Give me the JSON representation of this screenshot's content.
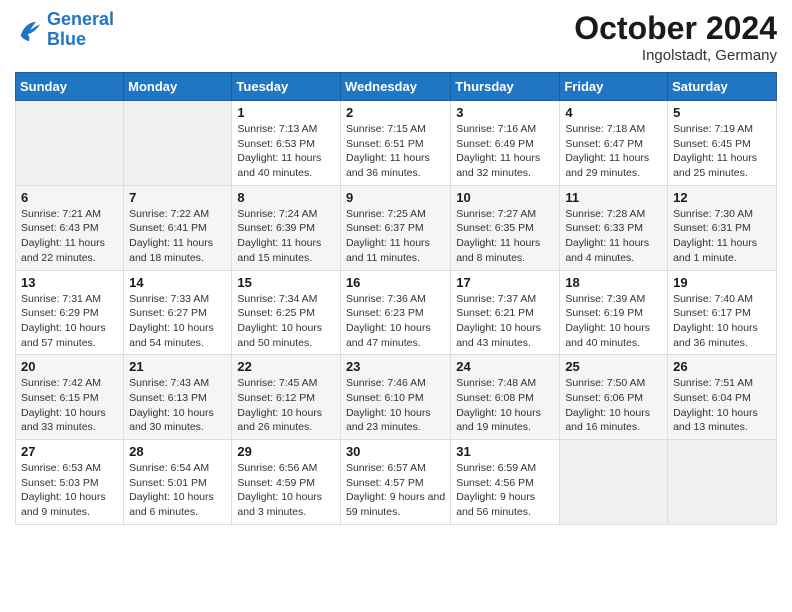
{
  "logo": {
    "line1": "General",
    "line2": "Blue"
  },
  "title": "October 2024",
  "location": "Ingolstadt, Germany",
  "weekdays": [
    "Sunday",
    "Monday",
    "Tuesday",
    "Wednesday",
    "Thursday",
    "Friday",
    "Saturday"
  ],
  "weeks": [
    [
      {
        "day": "",
        "info": ""
      },
      {
        "day": "",
        "info": ""
      },
      {
        "day": "1",
        "info": "Sunrise: 7:13 AM\nSunset: 6:53 PM\nDaylight: 11 hours and 40 minutes."
      },
      {
        "day": "2",
        "info": "Sunrise: 7:15 AM\nSunset: 6:51 PM\nDaylight: 11 hours and 36 minutes."
      },
      {
        "day": "3",
        "info": "Sunrise: 7:16 AM\nSunset: 6:49 PM\nDaylight: 11 hours and 32 minutes."
      },
      {
        "day": "4",
        "info": "Sunrise: 7:18 AM\nSunset: 6:47 PM\nDaylight: 11 hours and 29 minutes."
      },
      {
        "day": "5",
        "info": "Sunrise: 7:19 AM\nSunset: 6:45 PM\nDaylight: 11 hours and 25 minutes."
      }
    ],
    [
      {
        "day": "6",
        "info": "Sunrise: 7:21 AM\nSunset: 6:43 PM\nDaylight: 11 hours and 22 minutes."
      },
      {
        "day": "7",
        "info": "Sunrise: 7:22 AM\nSunset: 6:41 PM\nDaylight: 11 hours and 18 minutes."
      },
      {
        "day": "8",
        "info": "Sunrise: 7:24 AM\nSunset: 6:39 PM\nDaylight: 11 hours and 15 minutes."
      },
      {
        "day": "9",
        "info": "Sunrise: 7:25 AM\nSunset: 6:37 PM\nDaylight: 11 hours and 11 minutes."
      },
      {
        "day": "10",
        "info": "Sunrise: 7:27 AM\nSunset: 6:35 PM\nDaylight: 11 hours and 8 minutes."
      },
      {
        "day": "11",
        "info": "Sunrise: 7:28 AM\nSunset: 6:33 PM\nDaylight: 11 hours and 4 minutes."
      },
      {
        "day": "12",
        "info": "Sunrise: 7:30 AM\nSunset: 6:31 PM\nDaylight: 11 hours and 1 minute."
      }
    ],
    [
      {
        "day": "13",
        "info": "Sunrise: 7:31 AM\nSunset: 6:29 PM\nDaylight: 10 hours and 57 minutes."
      },
      {
        "day": "14",
        "info": "Sunrise: 7:33 AM\nSunset: 6:27 PM\nDaylight: 10 hours and 54 minutes."
      },
      {
        "day": "15",
        "info": "Sunrise: 7:34 AM\nSunset: 6:25 PM\nDaylight: 10 hours and 50 minutes."
      },
      {
        "day": "16",
        "info": "Sunrise: 7:36 AM\nSunset: 6:23 PM\nDaylight: 10 hours and 47 minutes."
      },
      {
        "day": "17",
        "info": "Sunrise: 7:37 AM\nSunset: 6:21 PM\nDaylight: 10 hours and 43 minutes."
      },
      {
        "day": "18",
        "info": "Sunrise: 7:39 AM\nSunset: 6:19 PM\nDaylight: 10 hours and 40 minutes."
      },
      {
        "day": "19",
        "info": "Sunrise: 7:40 AM\nSunset: 6:17 PM\nDaylight: 10 hours and 36 minutes."
      }
    ],
    [
      {
        "day": "20",
        "info": "Sunrise: 7:42 AM\nSunset: 6:15 PM\nDaylight: 10 hours and 33 minutes."
      },
      {
        "day": "21",
        "info": "Sunrise: 7:43 AM\nSunset: 6:13 PM\nDaylight: 10 hours and 30 minutes."
      },
      {
        "day": "22",
        "info": "Sunrise: 7:45 AM\nSunset: 6:12 PM\nDaylight: 10 hours and 26 minutes."
      },
      {
        "day": "23",
        "info": "Sunrise: 7:46 AM\nSunset: 6:10 PM\nDaylight: 10 hours and 23 minutes."
      },
      {
        "day": "24",
        "info": "Sunrise: 7:48 AM\nSunset: 6:08 PM\nDaylight: 10 hours and 19 minutes."
      },
      {
        "day": "25",
        "info": "Sunrise: 7:50 AM\nSunset: 6:06 PM\nDaylight: 10 hours and 16 minutes."
      },
      {
        "day": "26",
        "info": "Sunrise: 7:51 AM\nSunset: 6:04 PM\nDaylight: 10 hours and 13 minutes."
      }
    ],
    [
      {
        "day": "27",
        "info": "Sunrise: 6:53 AM\nSunset: 5:03 PM\nDaylight: 10 hours and 9 minutes."
      },
      {
        "day": "28",
        "info": "Sunrise: 6:54 AM\nSunset: 5:01 PM\nDaylight: 10 hours and 6 minutes."
      },
      {
        "day": "29",
        "info": "Sunrise: 6:56 AM\nSunset: 4:59 PM\nDaylight: 10 hours and 3 minutes."
      },
      {
        "day": "30",
        "info": "Sunrise: 6:57 AM\nSunset: 4:57 PM\nDaylight: 9 hours and 59 minutes."
      },
      {
        "day": "31",
        "info": "Sunrise: 6:59 AM\nSunset: 4:56 PM\nDaylight: 9 hours and 56 minutes."
      },
      {
        "day": "",
        "info": ""
      },
      {
        "day": "",
        "info": ""
      }
    ]
  ]
}
